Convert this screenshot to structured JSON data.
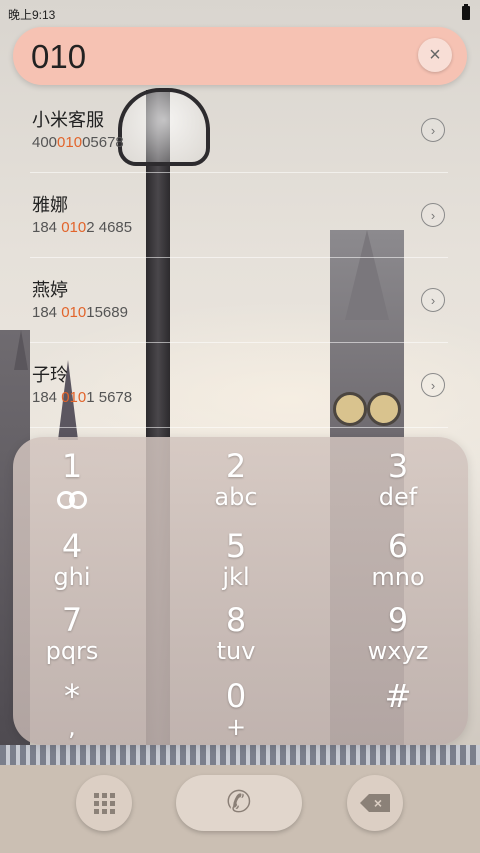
{
  "status_bar": {
    "time": "晚上9:13",
    "battery_icon": "battery-full-icon"
  },
  "search": {
    "query": "010",
    "clear_icon": "close-icon",
    "clear_symbol": "×"
  },
  "results": [
    {
      "name": "小米客服",
      "number_pre": "400",
      "number_match": "010",
      "number_post": "05678"
    },
    {
      "name": "雅娜",
      "number_pre": "184 ",
      "number_match": "010",
      "number_post": "2 4685"
    },
    {
      "name": "燕婷",
      "number_pre": "184 ",
      "number_match": "010",
      "number_post": "15689"
    },
    {
      "name": "子玲",
      "number_pre": "184 ",
      "number_match": "010",
      "number_post": "1 5678"
    }
  ],
  "detail_symbol": "›",
  "keypad": {
    "keys": [
      {
        "digit": "1",
        "letters": "",
        "icon": "voicemail-icon"
      },
      {
        "digit": "2",
        "letters": "abc"
      },
      {
        "digit": "3",
        "letters": "def"
      },
      {
        "digit": "4",
        "letters": "ghi"
      },
      {
        "digit": "5",
        "letters": "jkl"
      },
      {
        "digit": "6",
        "letters": "mno"
      },
      {
        "digit": "7",
        "letters": "pqrs"
      },
      {
        "digit": "8",
        "letters": "tuv"
      },
      {
        "digit": "9",
        "letters": "wxyz"
      },
      {
        "digit": "*",
        "letters": ","
      },
      {
        "digit": "0",
        "letters": "+"
      },
      {
        "digit": "#",
        "letters": ""
      }
    ]
  },
  "bottom_bar": {
    "dialpad_icon": "dialpad-grid-icon",
    "call_icon": "phone-icon",
    "call_symbol": "✆",
    "backspace_icon": "backspace-icon",
    "backspace_symbol": "×"
  },
  "colors": {
    "search_bg": "#f6c2b3",
    "match_highlight": "#e2642b"
  }
}
